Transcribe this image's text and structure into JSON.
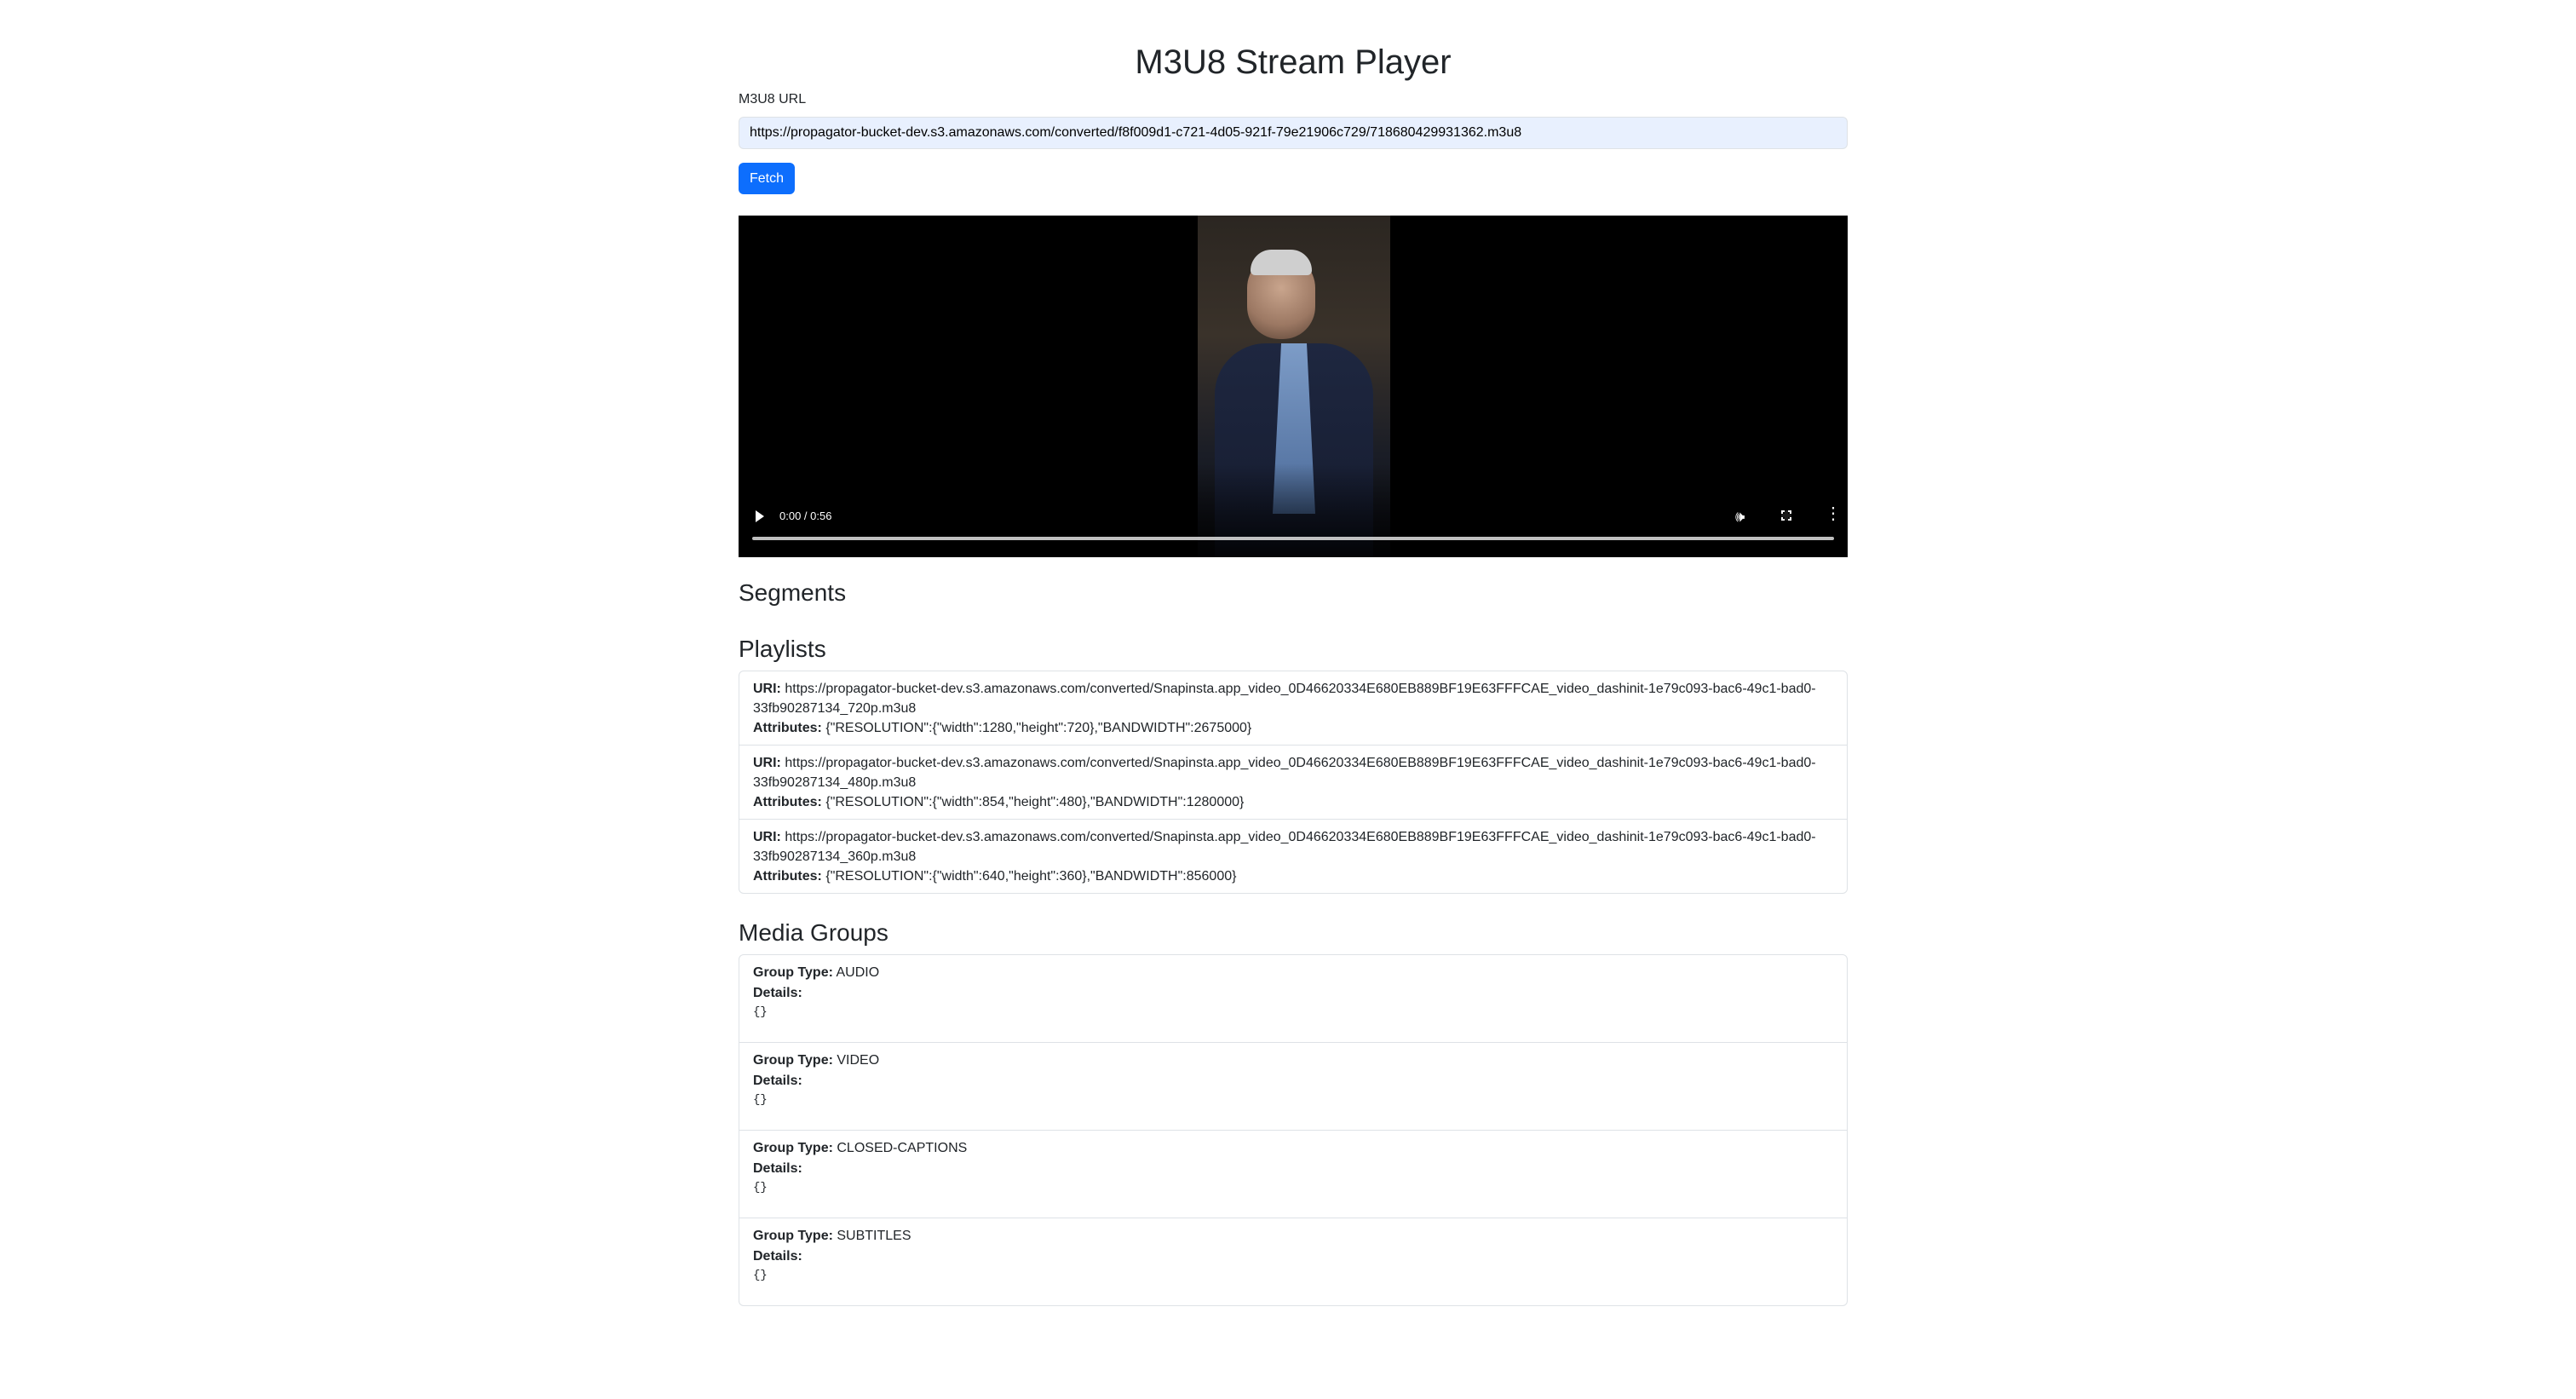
{
  "page": {
    "title": "M3U8 Stream Player"
  },
  "form": {
    "url_label": "M3U8 URL",
    "url_value": "https://propagator-bucket-dev.s3.amazonaws.com/converted/f8f009d1-c721-4d05-921f-79e21906c729/718680429931362.m3u8",
    "fetch_label": "Fetch"
  },
  "player": {
    "time_display": "0:00 / 0:56",
    "progress_fraction": 0
  },
  "segments": {
    "heading": "Segments"
  },
  "playlists": {
    "heading": "Playlists",
    "uri_label": "URI:",
    "attributes_label": "Attributes:",
    "items": [
      {
        "uri": "https://propagator-bucket-dev.s3.amazonaws.com/converted/Snapinsta.app_video_0D46620334E680EB889BF19E63FFFCAE_video_dashinit-1e79c093-bac6-49c1-bad0-33fb90287134_720p.m3u8",
        "attributes": "{\"RESOLUTION\":{\"width\":1280,\"height\":720},\"BANDWIDTH\":2675000}"
      },
      {
        "uri": "https://propagator-bucket-dev.s3.amazonaws.com/converted/Snapinsta.app_video_0D46620334E680EB889BF19E63FFFCAE_video_dashinit-1e79c093-bac6-49c1-bad0-33fb90287134_480p.m3u8",
        "attributes": "{\"RESOLUTION\":{\"width\":854,\"height\":480},\"BANDWIDTH\":1280000}"
      },
      {
        "uri": "https://propagator-bucket-dev.s3.amazonaws.com/converted/Snapinsta.app_video_0D46620334E680EB889BF19E63FFFCAE_video_dashinit-1e79c093-bac6-49c1-bad0-33fb90287134_360p.m3u8",
        "attributes": "{\"RESOLUTION\":{\"width\":640,\"height\":360},\"BANDWIDTH\":856000}"
      }
    ]
  },
  "media_groups": {
    "heading": "Media Groups",
    "group_type_label": "Group Type:",
    "details_label": "Details:",
    "items": [
      {
        "type": "AUDIO",
        "details": "{}"
      },
      {
        "type": "VIDEO",
        "details": "{}"
      },
      {
        "type": "CLOSED-CAPTIONS",
        "details": "{}"
      },
      {
        "type": "SUBTITLES",
        "details": "{}"
      }
    ]
  }
}
